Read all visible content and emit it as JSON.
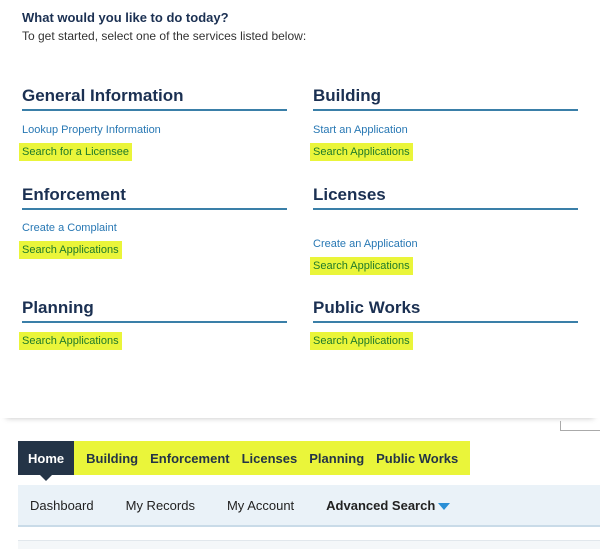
{
  "intro": {
    "title": "What would you like to do today?",
    "subtitle": "To get started, select one of the services listed below:"
  },
  "sections": {
    "general": {
      "title": "General Information",
      "links": [
        "Lookup Property Information",
        "Search for a Licensee"
      ]
    },
    "building": {
      "title": "Building",
      "links": [
        "Start an Application",
        "Search Applications"
      ]
    },
    "enforcement": {
      "title": "Enforcement",
      "links": [
        "Create a Complaint",
        "Search Applications"
      ]
    },
    "licenses": {
      "title": "Licenses",
      "links": [
        "Create an Application",
        "Search Applications"
      ]
    },
    "planning": {
      "title": "Planning",
      "links": [
        "Search Applications"
      ]
    },
    "public_works": {
      "title": "Public Works",
      "links": [
        "Search Applications"
      ]
    }
  },
  "tabs": [
    "Home",
    "Building",
    "Enforcement",
    "Licenses",
    "Planning",
    "Public Works"
  ],
  "subnav": [
    "Dashboard",
    "My Records",
    "My Account",
    "Advanced Search"
  ],
  "colors": {
    "highlight": "#eaf53a",
    "heading": "#1b3052",
    "link": "#2878b4",
    "tab_active": "#243447"
  }
}
